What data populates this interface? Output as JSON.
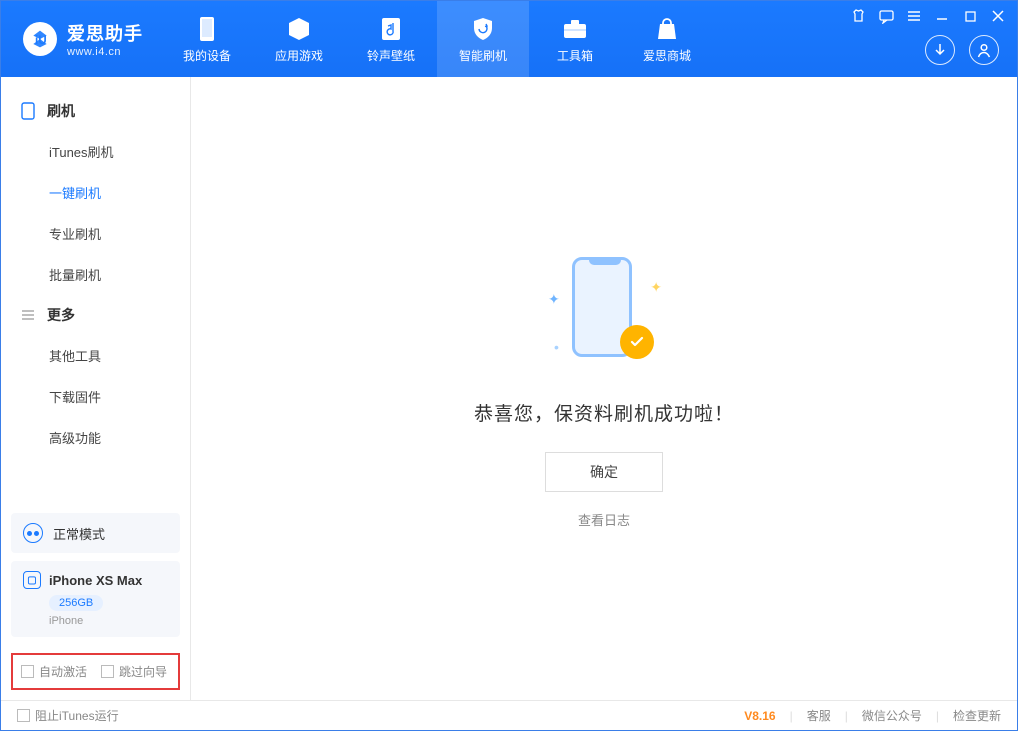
{
  "app": {
    "name_cn": "爱思助手",
    "name_en": "www.i4.cn"
  },
  "nav": {
    "items": [
      {
        "label": "我的设备"
      },
      {
        "label": "应用游戏"
      },
      {
        "label": "铃声壁纸"
      },
      {
        "label": "智能刷机"
      },
      {
        "label": "工具箱"
      },
      {
        "label": "爱思商城"
      }
    ]
  },
  "sidebar": {
    "group1": {
      "title": "刷机",
      "items": [
        {
          "label": "iTunes刷机"
        },
        {
          "label": "一键刷机"
        },
        {
          "label": "专业刷机"
        },
        {
          "label": "批量刷机"
        }
      ]
    },
    "group2": {
      "title": "更多",
      "items": [
        {
          "label": "其他工具"
        },
        {
          "label": "下载固件"
        },
        {
          "label": "高级功能"
        }
      ]
    },
    "mode": {
      "label": "正常模式"
    },
    "device": {
      "name": "iPhone XS Max",
      "storage": "256GB",
      "type": "iPhone"
    },
    "checks": {
      "auto_activate": "自动激活",
      "skip_guide": "跳过向导"
    }
  },
  "main": {
    "success_text": "恭喜您，保资料刷机成功啦！",
    "ok_button": "确定",
    "view_log": "查看日志"
  },
  "footer": {
    "stop_itunes": "阻止iTunes运行",
    "version": "V8.16",
    "links": [
      "客服",
      "微信公众号",
      "检查更新"
    ]
  }
}
